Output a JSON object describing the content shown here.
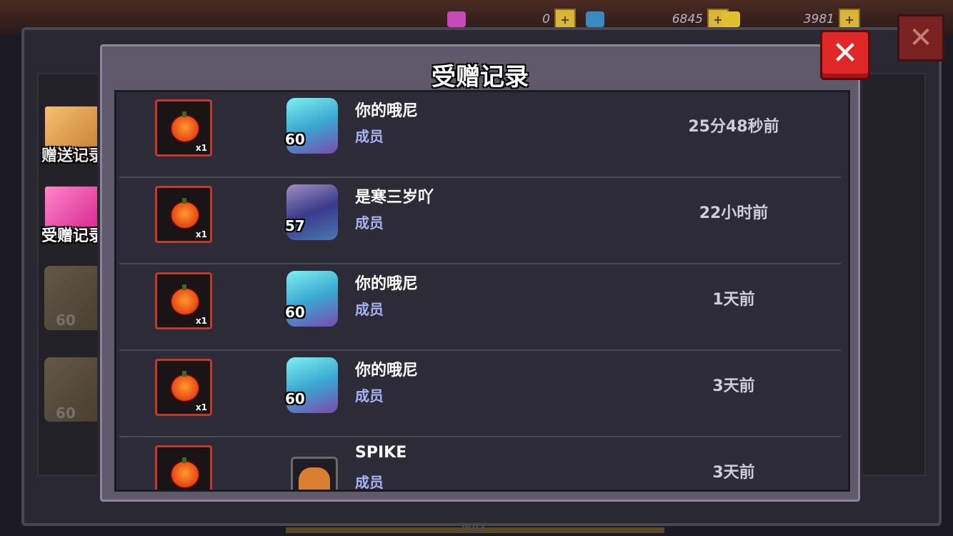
{
  "resources": [
    {
      "value": "0",
      "gem_color": "#c84ab8"
    },
    {
      "value": "6845",
      "gem_color": "#3a8ac0"
    },
    {
      "value": "3981",
      "gem_color": "#e0c030"
    }
  ],
  "tabs": [
    {
      "label": "赠送记录"
    },
    {
      "label": "受赠记录"
    }
  ],
  "background_levels": [
    "60",
    "60"
  ],
  "max_label": "MAX",
  "modal": {
    "title": "受赠记录",
    "close_symbol": "✕"
  },
  "records": [
    {
      "item_qty": "x1",
      "level": "60",
      "name": "你的哦尼",
      "role": "成员",
      "time": "25分48秒前",
      "avatar": "cyan"
    },
    {
      "item_qty": "x1",
      "level": "57",
      "name": "是寒三岁吖",
      "role": "成员",
      "time": "22小时前",
      "avatar": "dark"
    },
    {
      "item_qty": "x1",
      "level": "60",
      "name": "你的哦尼",
      "role": "成员",
      "time": "1天前",
      "avatar": "cyan"
    },
    {
      "item_qty": "x1",
      "level": "60",
      "name": "你的哦尼",
      "role": "成员",
      "time": "3天前",
      "avatar": "cyan"
    },
    {
      "item_qty": "",
      "level": "",
      "name": "SPIKE",
      "role": "成员",
      "time": "3天前",
      "avatar": "horse"
    }
  ]
}
